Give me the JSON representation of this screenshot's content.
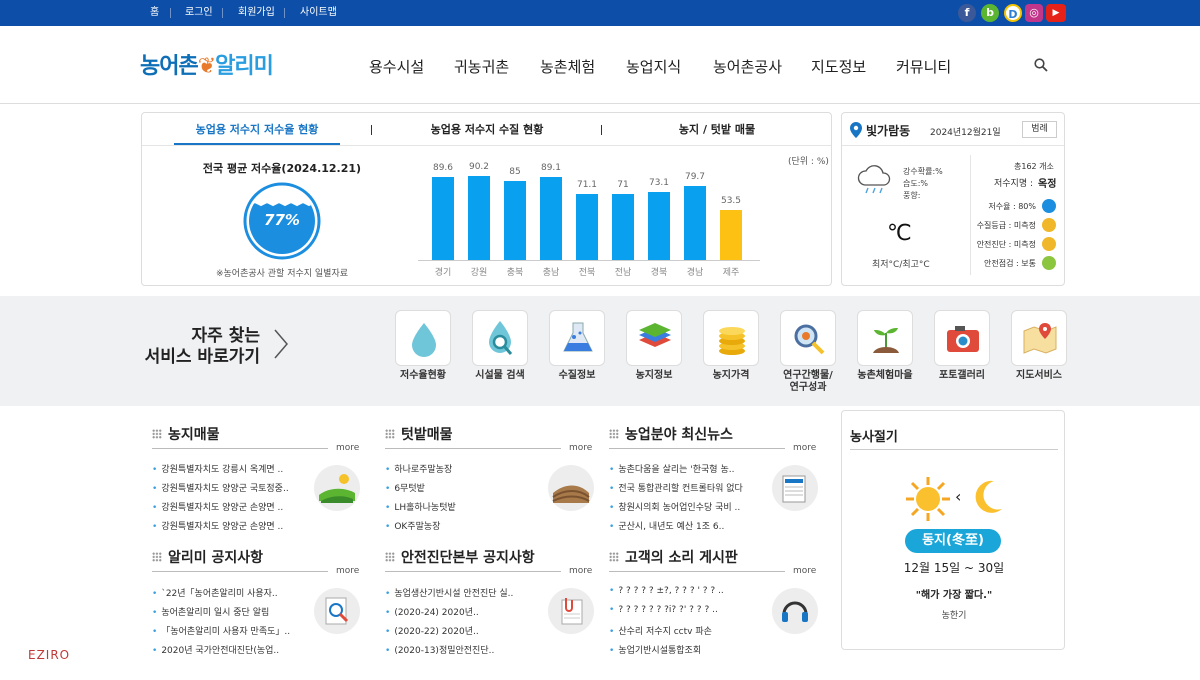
{
  "topbar": {
    "links": [
      "홈",
      "로그인",
      "회원가입",
      "사이트맵"
    ],
    "social": [
      "facebook-icon",
      "blog-icon",
      "kakao-icon",
      "instagram-icon",
      "youtube-icon"
    ]
  },
  "header": {
    "logo": {
      "part1": "농어촌",
      "part2": "알리미"
    },
    "nav": [
      "용수시설",
      "귀농귀촌",
      "농촌체험",
      "농업지식",
      "농어촌공사",
      "지도정보",
      "커뮤니티"
    ]
  },
  "reservoir": {
    "tabs": [
      "농업용 저수지 저수율 현황",
      "농업용 저수지 수질 현황",
      "농지 / 텃밭 매물"
    ],
    "avg_title": "전국 평균 저수율(2024.12.21)",
    "avg_value": "77%",
    "avg_fill": 0.77,
    "note": "※농어촌공사 관할 저수지 일별자료",
    "unit": "(단위 : %)"
  },
  "chart_data": {
    "type": "bar",
    "categories": [
      "경기",
      "강원",
      "충북",
      "충남",
      "전북",
      "전남",
      "경북",
      "경남",
      "제주"
    ],
    "values": [
      89.6,
      90.2,
      85,
      89.1,
      71.1,
      71,
      73.1,
      79.7,
      53.5
    ],
    "ylabel": "",
    "colors": [
      "#0aa0f0",
      "#0aa0f0",
      "#0aa0f0",
      "#0aa0f0",
      "#0aa0f0",
      "#0aa0f0",
      "#0aa0f0",
      "#0aa0f0",
      "#fdc114"
    ]
  },
  "weather": {
    "location": "빛가람동",
    "date": "2024년12월21일",
    "legend_btn": "범례",
    "rain": "강수확률:%",
    "humidity": "습도:%",
    "wind": "풍향:",
    "temp_unit": "℃",
    "minmax": "최저°C/최고°C",
    "total": "총162 개소",
    "place_label": "저수지명 :",
    "place": "옥정",
    "items": [
      {
        "label": "저수율 : 80%",
        "color": "#1c8ee0"
      },
      {
        "label": "수질등급 : 미측정",
        "color": "#f1b72a"
      },
      {
        "label": "안전진단 : 미측정",
        "color": "#f1b72a"
      },
      {
        "label": "안전점검 : 보통",
        "color": "#8cc63f"
      }
    ]
  },
  "services": {
    "title_line1": "자주 찾는",
    "title_line2": "서비스 바로가기",
    "items": [
      {
        "label": "저수율현황",
        "icon": "water-drop-icon"
      },
      {
        "label": "시설물 검색",
        "icon": "search-drop-icon"
      },
      {
        "label": "수질정보",
        "icon": "flask-icon"
      },
      {
        "label": "농지정보",
        "icon": "land-layers-icon"
      },
      {
        "label": "농지가격",
        "icon": "coins-icon"
      },
      {
        "label": "연구간행물/\n연구성과",
        "icon": "magnifier-icon"
      },
      {
        "label": "농촌체험마을",
        "icon": "sprout-icon"
      },
      {
        "label": "포토갤러리",
        "icon": "camera-icon"
      },
      {
        "label": "지도서비스",
        "icon": "map-icon"
      }
    ]
  },
  "boards": {
    "more": "more",
    "farmland": {
      "title": "농지매물",
      "items": [
        "강원특별자치도 강릉시 옥계면 ..",
        "강원특별자치도 양양군 국토정중..",
        "강원특별자치도 양양군 손양면 ..",
        "강원특별자치도 양양군 손양면 .."
      ]
    },
    "garden": {
      "title": "텃밭매물",
      "items": [
        "하나로주말농장",
        "6무텃밭",
        "LH홀하나농텃밭",
        "OK주말농장"
      ]
    },
    "news": {
      "title": "농업분야 최신뉴스",
      "items": [
        "농촌다움을 살리는 '한국형 농..",
        "전국 통합관리할 컨트롤타워 없다",
        "창원시의회 농어업인수당 국비 ..",
        "군산시, 내년도 예산 1조 6.."
      ]
    },
    "notice": {
      "title": "알리미 공지사항",
      "items": [
        "`22년「농어촌알리미 사용자..",
        "농어촌알리미 일시 중단 알림",
        "「농어촌알리미 사용자 만족도」..",
        "2020년 국가안전대진단(농업.."
      ]
    },
    "safety": {
      "title": "안전진단본부 공지사항",
      "items": [
        "농업생산기반시설 안전진단 실..",
        "(2020-24) 2020년..",
        "(2020-22) 2020년..",
        "(2020-13)정밀안전진단.."
      ]
    },
    "voice": {
      "title": "고객의 소리 게시판",
      "items": [
        "? ? ? ? ? ±?, ? ? ? ' ? ? ..",
        "? ? ? ? ? ? ?i? ?' ? ? ? ..",
        "산수리 저수지 cctv 파손",
        "농업기반시설통합조회"
      ]
    }
  },
  "season": {
    "title": "농사절기",
    "name": "동지(冬至)",
    "date": "12월 15일 ~ 30일",
    "quote": "\"해가 가장 짧다.\"",
    "sub": "농한기"
  },
  "footer": {
    "brand": "EZIRO"
  }
}
